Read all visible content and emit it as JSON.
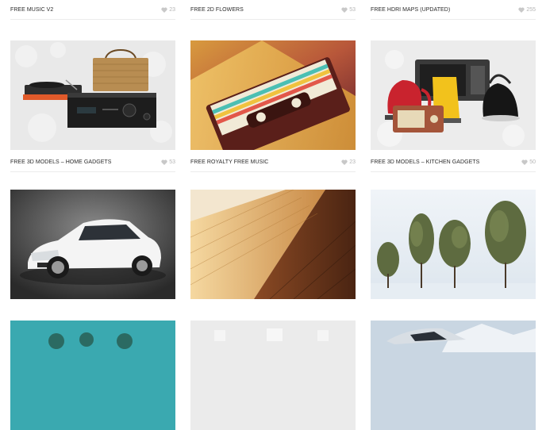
{
  "cards": [
    {
      "title": "FREE MUSIC V2",
      "likes": "23"
    },
    {
      "title": "FREE 2D FLOWERS",
      "likes": "53"
    },
    {
      "title": "FREE HDRI MAPS (UPDATED)",
      "likes": "255"
    },
    {
      "title": "FREE 3D MODELS – HOME GADGETS",
      "likes": "53",
      "image": "home-gadgets-image"
    },
    {
      "title": "FREE ROYALTY FREE MUSIC",
      "likes": "23",
      "image": "cassette-tape-image"
    },
    {
      "title": "FREE 3D MODELS – KITCHEN GADGETS",
      "likes": "50",
      "image": "kitchen-gadgets-image"
    },
    {
      "image": "car-image"
    },
    {
      "image": "wood-floor-image"
    },
    {
      "image": "trees-image"
    },
    {
      "image": "teal-image"
    },
    {
      "image": "furniture-image"
    },
    {
      "image": "sports-car-image"
    }
  ],
  "icons": {
    "like": "heart-icon"
  },
  "colors": {
    "title": "#2b2b2b",
    "likes": "#b5b5b5",
    "separator": "#ececec"
  }
}
